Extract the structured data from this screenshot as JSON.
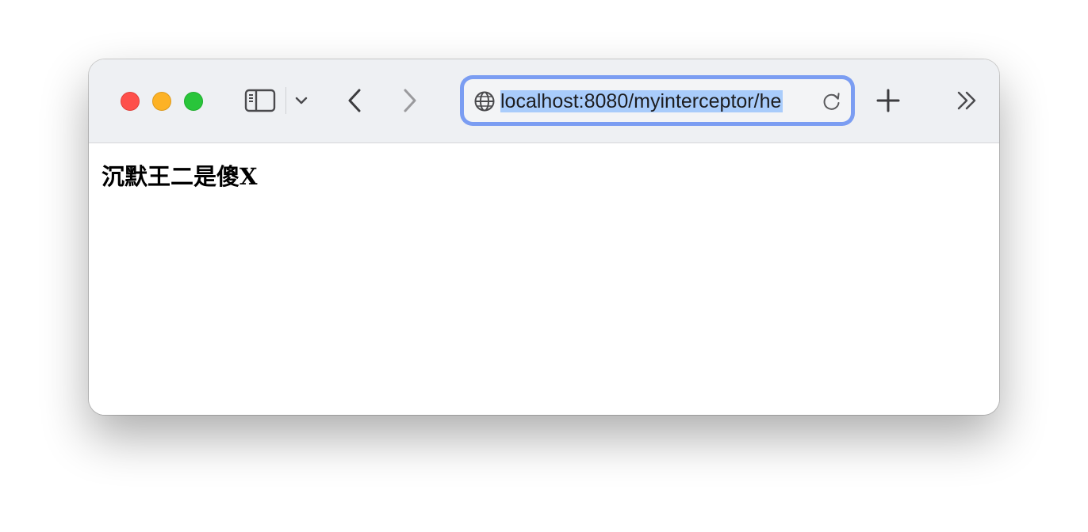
{
  "browser": {
    "url": "localhost:8080/myinterceptor/he",
    "icons": {
      "close": "close-traffic-light",
      "minimize": "minimize-traffic-light",
      "maximize": "maximize-traffic-light",
      "sidebar": "sidebar-icon",
      "tab_menu": "chevron-down-icon",
      "back": "chevron-left-icon",
      "forward": "chevron-right-icon",
      "site": "globe-icon",
      "reload": "reload-icon",
      "new_tab": "plus-icon",
      "overflow": "double-chevron-right-icon"
    },
    "colors": {
      "close": "#fe4f4a",
      "minimize": "#fdb225",
      "maximize": "#29c53a",
      "url_focus_ring": "#7b9df2",
      "url_selection": "#a9ccfb"
    }
  },
  "page": {
    "text": "沉默王二是傻X"
  }
}
